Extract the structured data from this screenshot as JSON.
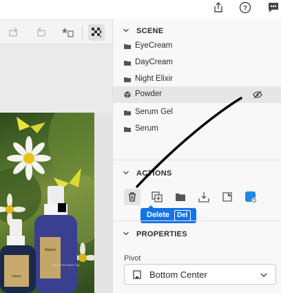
{
  "scene": {
    "title": "SCENE",
    "layers": [
      {
        "name": "EyeCream",
        "icon": "folder-icon",
        "selected": false
      },
      {
        "name": "DayCream",
        "icon": "folder-icon",
        "selected": false
      },
      {
        "name": "Night Elixir",
        "icon": "folder-icon",
        "selected": false
      },
      {
        "name": "Powder",
        "icon": "cube-icon",
        "selected": true,
        "hidden": true
      },
      {
        "name": "Serum Gel",
        "icon": "folder-icon",
        "selected": false
      },
      {
        "name": "Serum",
        "icon": "folder-icon",
        "selected": false
      }
    ]
  },
  "actions": {
    "title": "ACTIONS",
    "buttons": [
      "delete",
      "duplicate",
      "group",
      "import",
      "hide",
      "material-status"
    ],
    "tooltip": {
      "label": "Delete",
      "shortcut": "Del"
    }
  },
  "properties": {
    "title": "PROPERTIES",
    "pivot_label": "Pivot",
    "pivot_value": "Bottom Center"
  },
  "photo_labels": {
    "bottle_left": "Atlantic",
    "bottle_right": "DISCOVER BODY OIL"
  },
  "colors": {
    "accent": "#1473e6",
    "selected_row": "#e6e6e6",
    "panel_bg": "#f8f8f8"
  }
}
